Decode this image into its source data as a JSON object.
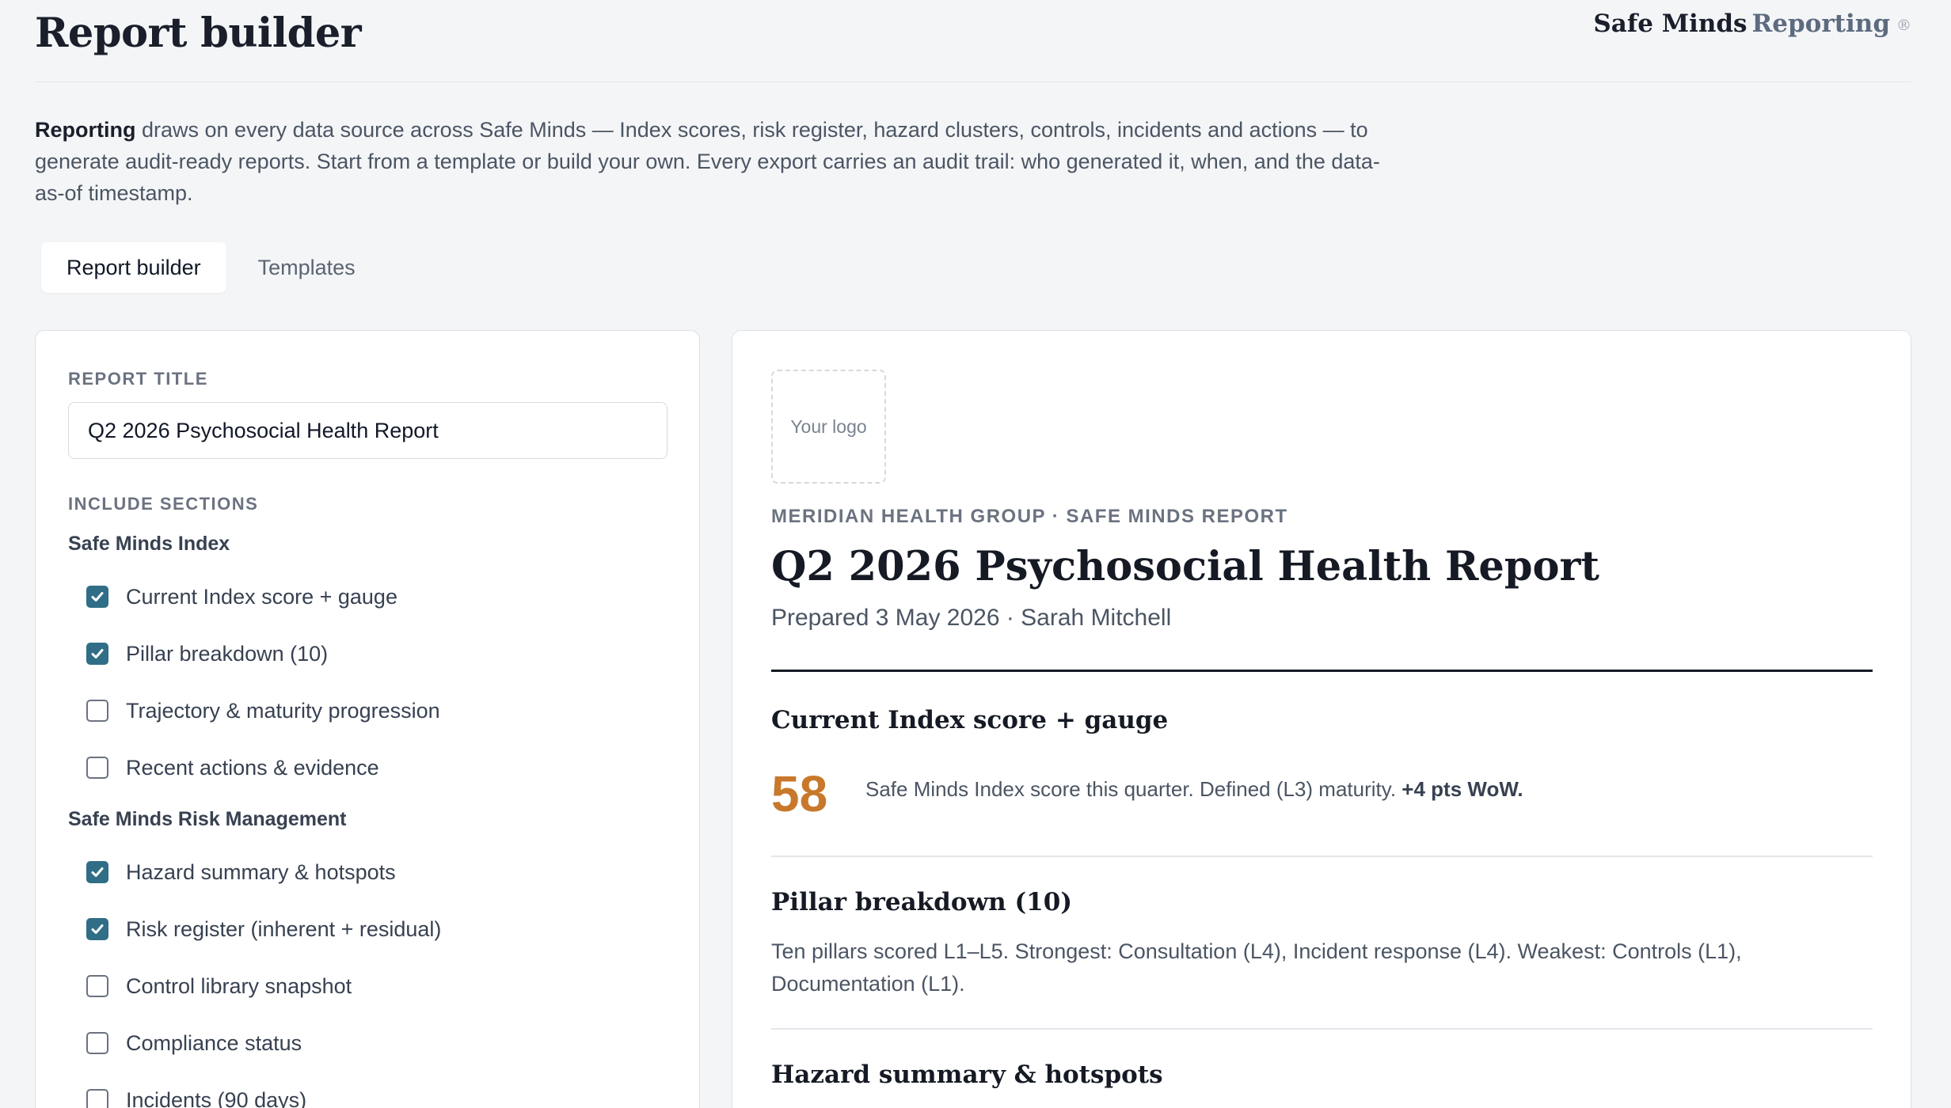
{
  "header": {
    "title": "Report builder",
    "brand_primary": "Safe Minds",
    "brand_secondary": "Reporting",
    "brand_mark": "®"
  },
  "intro": {
    "lead": "Reporting",
    "text": " draws on every data source across Safe Minds — Index scores, risk register, hazard clusters, controls, incidents and actions — to generate audit-ready reports. Start from a template or build your own. Every export carries an audit trail: who generated it, when, and the data-as-of timestamp."
  },
  "tabs": [
    {
      "label": "Report builder",
      "active": true
    },
    {
      "label": "Templates",
      "active": false
    }
  ],
  "builder": {
    "title_label": "REPORT TITLE",
    "title_value": "Q2 2026 Psychosocial Health Report",
    "sections_label": "INCLUDE SECTIONS",
    "groups": [
      {
        "heading": "Safe Minds Index",
        "items": [
          {
            "label": "Current Index score + gauge",
            "checked": true
          },
          {
            "label": "Pillar breakdown (10)",
            "checked": true
          },
          {
            "label": "Trajectory & maturity progression",
            "checked": false
          },
          {
            "label": "Recent actions & evidence",
            "checked": false
          }
        ]
      },
      {
        "heading": "Safe Minds Risk Management",
        "items": [
          {
            "label": "Hazard summary & hotspots",
            "checked": true
          },
          {
            "label": "Risk register (inherent + residual)",
            "checked": true
          },
          {
            "label": "Control library snapshot",
            "checked": false
          },
          {
            "label": "Compliance status",
            "checked": false
          },
          {
            "label": "Incidents (90 days)",
            "checked": false
          }
        ]
      }
    ]
  },
  "preview": {
    "logo_placeholder": "Your logo",
    "org_line": "MERIDIAN HEALTH GROUP · SAFE MINDS REPORT",
    "title": "Q2 2026 Psychosocial Health Report",
    "prepared": "Prepared 3 May 2026 · Sarah Mitchell",
    "sections": {
      "index": {
        "title": "Current Index score + gauge",
        "score": "58",
        "desc": "Safe Minds Index score this quarter. Defined (L3) maturity. ",
        "delta": "+4 pts WoW."
      },
      "pillars": {
        "title": "Pillar breakdown (10)",
        "desc": "Ten pillars scored L1–L5. Strongest: Consultation (L4), Incident response (L4). Weakest: Controls (L1), Documentation (L1)."
      },
      "hazards": {
        "title": "Hazard summary & hotspots"
      }
    }
  },
  "colors": {
    "accent_checkbox": "#2f6e86",
    "score": "#c8782b"
  }
}
